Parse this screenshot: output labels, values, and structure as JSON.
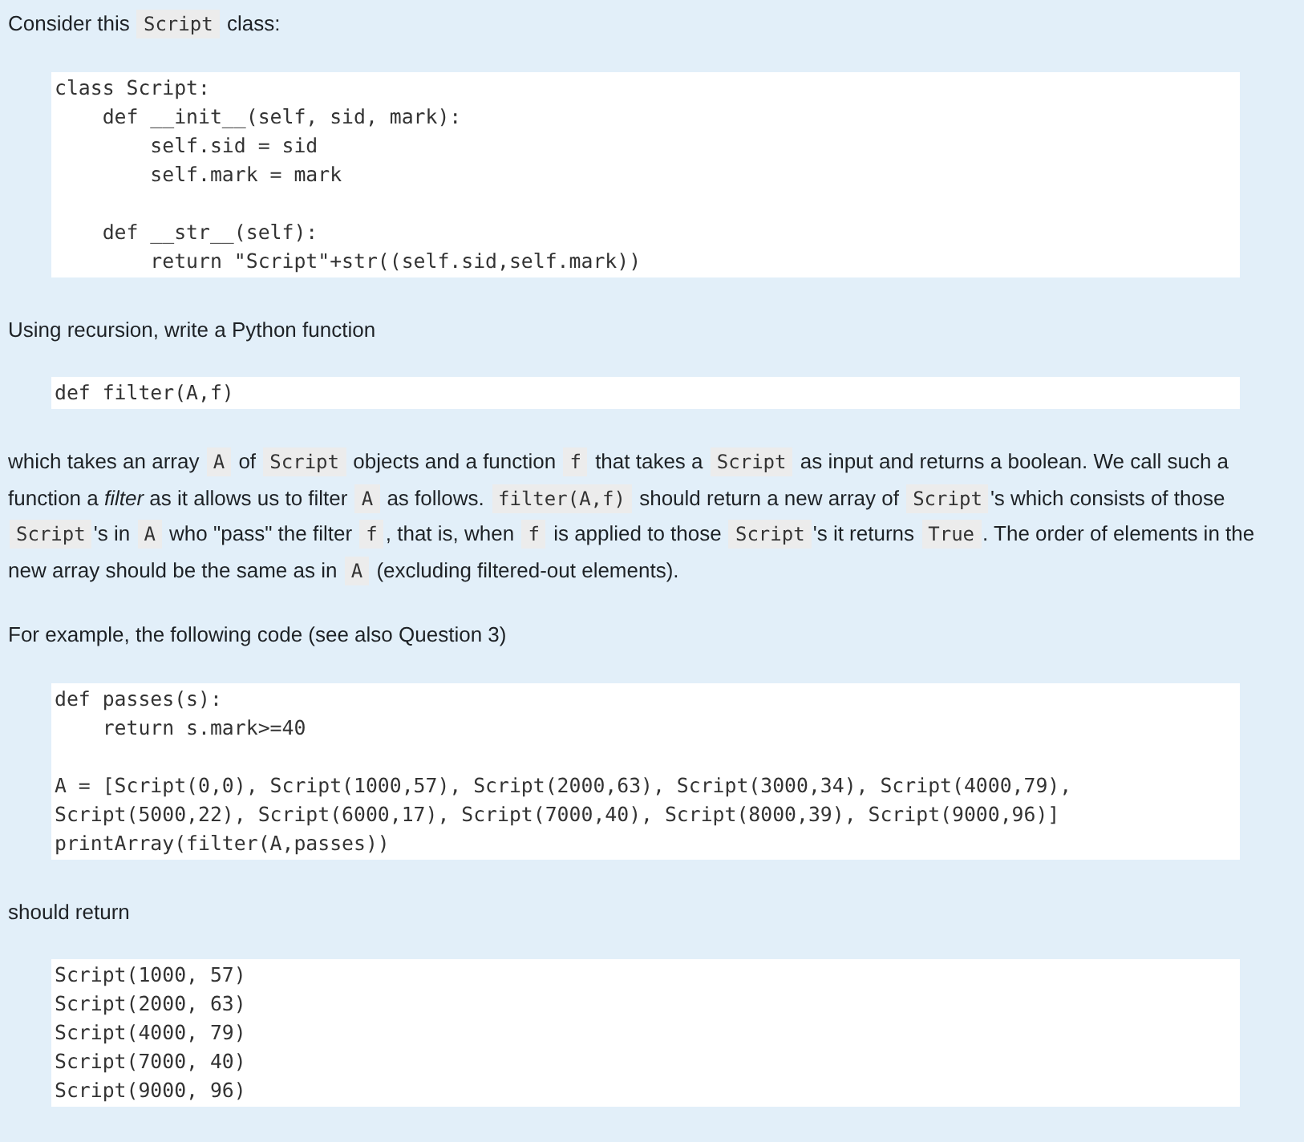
{
  "blocks": [
    {
      "kind": "para",
      "segments": [
        {
          "kind": "text",
          "text": "Consider this "
        },
        {
          "kind": "code",
          "text": "Script"
        },
        {
          "kind": "text",
          "text": " class:"
        }
      ]
    },
    {
      "kind": "code",
      "text": "class Script:\n    def __init__(self, sid, mark):\n        self.sid = sid\n        self.mark = mark\n\n    def __str__(self):\n        return \"Script\"+str((self.sid,self.mark))"
    },
    {
      "kind": "para",
      "segments": [
        {
          "kind": "text",
          "text": "Using recursion, write a Python function"
        }
      ]
    },
    {
      "kind": "code",
      "text": "def filter(A,f)"
    },
    {
      "kind": "para",
      "segments": [
        {
          "kind": "text",
          "text": "which takes an array "
        },
        {
          "kind": "code",
          "text": "A"
        },
        {
          "kind": "text",
          "text": " of "
        },
        {
          "kind": "code",
          "text": "Script"
        },
        {
          "kind": "text",
          "text": " objects and a function "
        },
        {
          "kind": "code",
          "text": "f"
        },
        {
          "kind": "text",
          "text": " that takes a "
        },
        {
          "kind": "code",
          "text": "Script"
        },
        {
          "kind": "text",
          "text": " as input and returns a boolean. We call such a function a "
        },
        {
          "kind": "em",
          "text": "filter"
        },
        {
          "kind": "text",
          "text": " as it allows us to filter "
        },
        {
          "kind": "code",
          "text": "A"
        },
        {
          "kind": "text",
          "text": " as follows. "
        },
        {
          "kind": "code",
          "text": "filter(A,f)"
        },
        {
          "kind": "text",
          "text": " should return a new array of "
        },
        {
          "kind": "code",
          "text": "Script"
        },
        {
          "kind": "text",
          "text": "'s which consists of those "
        },
        {
          "kind": "code",
          "text": "Script"
        },
        {
          "kind": "text",
          "text": "'s in "
        },
        {
          "kind": "code",
          "text": "A"
        },
        {
          "kind": "text",
          "text": " who \"pass\" the filter "
        },
        {
          "kind": "code",
          "text": "f"
        },
        {
          "kind": "text",
          "text": ", that is, when "
        },
        {
          "kind": "code",
          "text": "f"
        },
        {
          "kind": "text",
          "text": " is applied to those "
        },
        {
          "kind": "code",
          "text": "Script"
        },
        {
          "kind": "text",
          "text": "'s it returns "
        },
        {
          "kind": "code",
          "text": "True"
        },
        {
          "kind": "text",
          "text": ". The order of elements in the new array should be the same as in "
        },
        {
          "kind": "code",
          "text": "A"
        },
        {
          "kind": "text",
          "text": " (excluding filtered-out elements)."
        }
      ]
    },
    {
      "kind": "para",
      "segments": [
        {
          "kind": "text",
          "text": "For example, the following code (see also Question 3)"
        }
      ]
    },
    {
      "kind": "code",
      "text": "def passes(s):\n    return s.mark>=40\n\nA = [Script(0,0), Script(1000,57), Script(2000,63), Script(3000,34), Script(4000,79),\nScript(5000,22), Script(6000,17), Script(7000,40), Script(8000,39), Script(9000,96)]\nprintArray(filter(A,passes))"
    },
    {
      "kind": "para",
      "segments": [
        {
          "kind": "text",
          "text": "should return"
        }
      ]
    },
    {
      "kind": "code",
      "text": "Script(1000, 57)\nScript(2000, 63)\nScript(4000, 79)\nScript(7000, 40)\nScript(9000, 96)"
    }
  ]
}
